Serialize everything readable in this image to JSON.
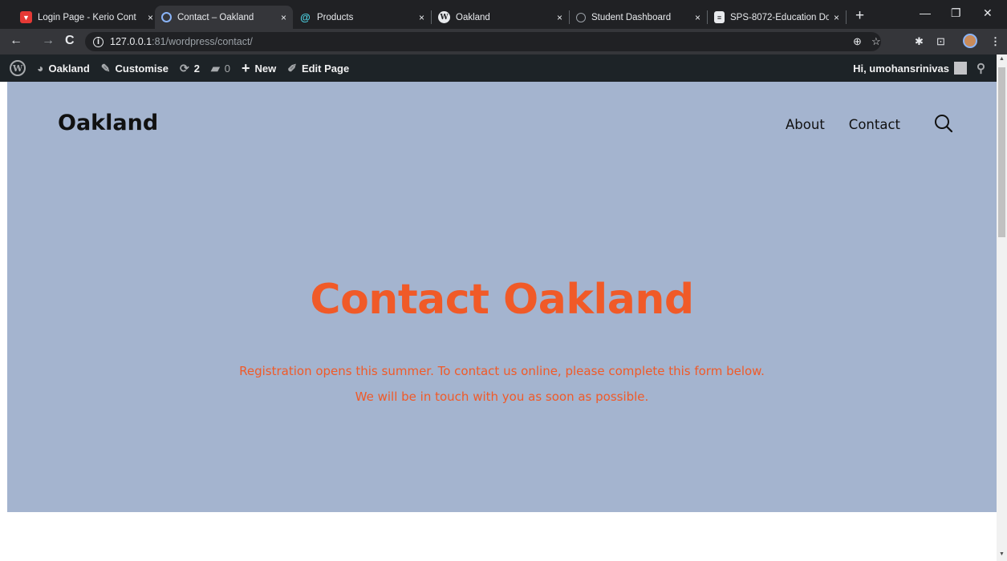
{
  "browser": {
    "tabs": [
      {
        "title": "Login Page - Kerio Cont",
        "favicon": "shield-icon",
        "active": false
      },
      {
        "title": "Contact – Oakland",
        "favicon": "loading-icon",
        "active": true
      },
      {
        "title": "Products",
        "favicon": "spiral-icon",
        "active": false
      },
      {
        "title": "Oakland",
        "favicon": "wordpress-icon",
        "active": false
      },
      {
        "title": "Student Dashboard",
        "favicon": "globe-icon",
        "active": false
      },
      {
        "title": "SPS-8072-Education Do",
        "favicon": "doc-icon",
        "active": false
      }
    ],
    "close_glyph": "×",
    "new_tab": "+",
    "url_host": "127.0.0.1",
    "url_rest": ":81/wordpress/contact/"
  },
  "adminbar": {
    "site_name": "Oakland",
    "customise": "Customise",
    "updates_count": "2",
    "comments_count": "0",
    "new_label": "New",
    "edit_page": "Edit Page",
    "greeting": "Hi, umohansrinivas"
  },
  "site": {
    "title": "Oakland",
    "nav": [
      "About",
      "Contact"
    ]
  },
  "hero": {
    "heading": "Contact Oakland",
    "text": "Registration opens this summer. To contact us online, please complete this form below. We will be in touch with you as soon as possible."
  },
  "colors": {
    "hero_bg": "#a4b4cf",
    "accent": "#f05a28",
    "adminbar_bg": "#1d2327"
  }
}
